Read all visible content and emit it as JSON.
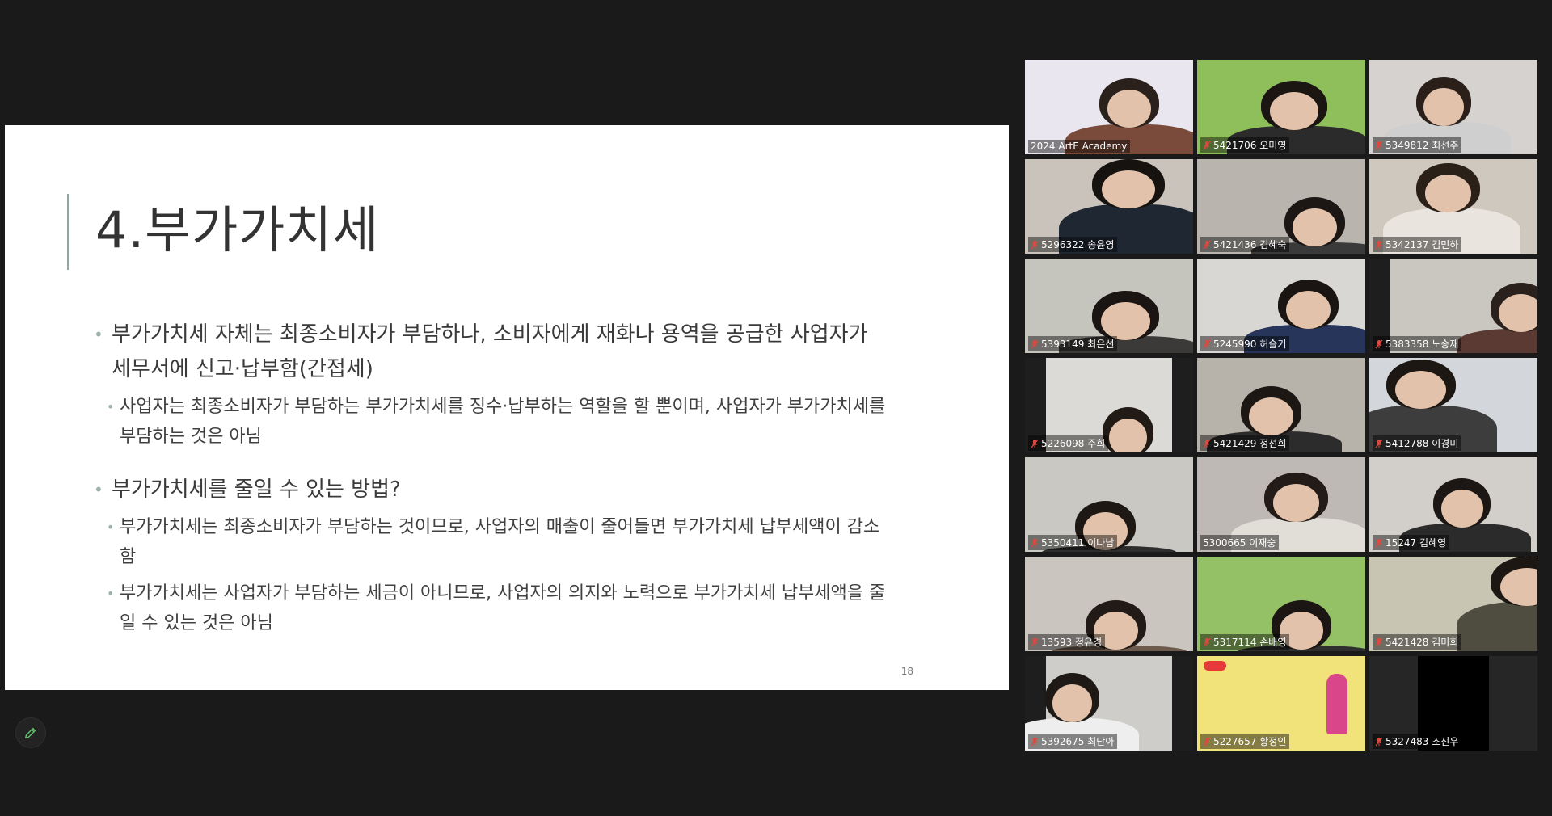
{
  "slide": {
    "title": "4.부가가치세",
    "bullets": [
      {
        "text": "부가가치세 자체는 최종소비자가 부담하나, 소비자에게 재화나 용역을 공급한 사업자가 세무서에 신고·납부함(간접세)"
      },
      {
        "text": "사업자는 최종소비자가 부담하는 부가가치세를 징수·납부하는 역할을 할 뿐이며, 사업자가 부가가치세를 부담하는 것은 아님"
      },
      {
        "text": "부가가치세를 줄일 수 있는 방법?"
      },
      {
        "text": "부가가치세는 최종소비자가 부담하는 것이므로, 사업자의 매출이 줄어들면 부가가치세 납부세액이 감소함"
      },
      {
        "text": "부가가치세는 사업자가 부담하는 세금이 아니므로, 사업자의 의지와 노력으로 부가가치세 납부세액을 줄일 수 있는 것은 아님"
      }
    ],
    "page_number": "18"
  },
  "participants": [
    {
      "name": "2024 ArtE Academy",
      "muted": false,
      "bg": "#e9e6ef",
      "active": true
    },
    {
      "name": "5421706 오미영",
      "muted": true,
      "bg": "#8fbf5a"
    },
    {
      "name": "5349812 최선주",
      "muted": true,
      "bg": "#d5d2cf"
    },
    {
      "name": "5296322 송윤영",
      "muted": true,
      "bg": "#c9c3bb"
    },
    {
      "name": "5421436 김혜숙",
      "muted": true,
      "bg": "#b9b4ae"
    },
    {
      "name": "5342137 김민하",
      "muted": true,
      "bg": "#cfc8bf"
    },
    {
      "name": "5393149 최은선",
      "muted": true,
      "bg": "#c6c5bd"
    },
    {
      "name": "5245990 허슬기",
      "muted": true,
      "bg": "#d9d7d3"
    },
    {
      "name": "5383358 노송재",
      "muted": true,
      "bg": "#cac7c0"
    },
    {
      "name": "5226098 주희",
      "muted": true,
      "bg": "#dcdad6"
    },
    {
      "name": "5421429 정선희",
      "muted": true,
      "bg": "#b8b3aa"
    },
    {
      "name": "5412788 이경미",
      "muted": true,
      "bg": "#d3d6da"
    },
    {
      "name": "5350411 이나남",
      "muted": true,
      "bg": "#c9c8c2"
    },
    {
      "name": "5300665 이재숭",
      "muted": false,
      "bg": "#bfb9b5"
    },
    {
      "name": "15247 김혜영",
      "muted": true,
      "bg": "#d2cfca"
    },
    {
      "name": "13593 정유경",
      "muted": true,
      "bg": "#cbc5bf"
    },
    {
      "name": "5317114 손배영",
      "muted": true,
      "bg": "#94c166"
    },
    {
      "name": "5421428 김미희",
      "muted": true,
      "bg": "#c8c5b3"
    },
    {
      "name": "5392675 최단아",
      "muted": true,
      "bg": "#cfcdc9"
    },
    {
      "name": "5227657 황정인",
      "muted": true,
      "bg": "#f2e27a"
    },
    {
      "name": "5327483 조신우",
      "muted": true,
      "bg": "#000000"
    }
  ],
  "colors": {
    "background": "#1a1a1a",
    "active_speaker_border": "#b8e03a",
    "muted_icon": "#e0483e"
  },
  "icons": {
    "annotate": "pencil-icon",
    "muted": "mic-off-icon"
  }
}
